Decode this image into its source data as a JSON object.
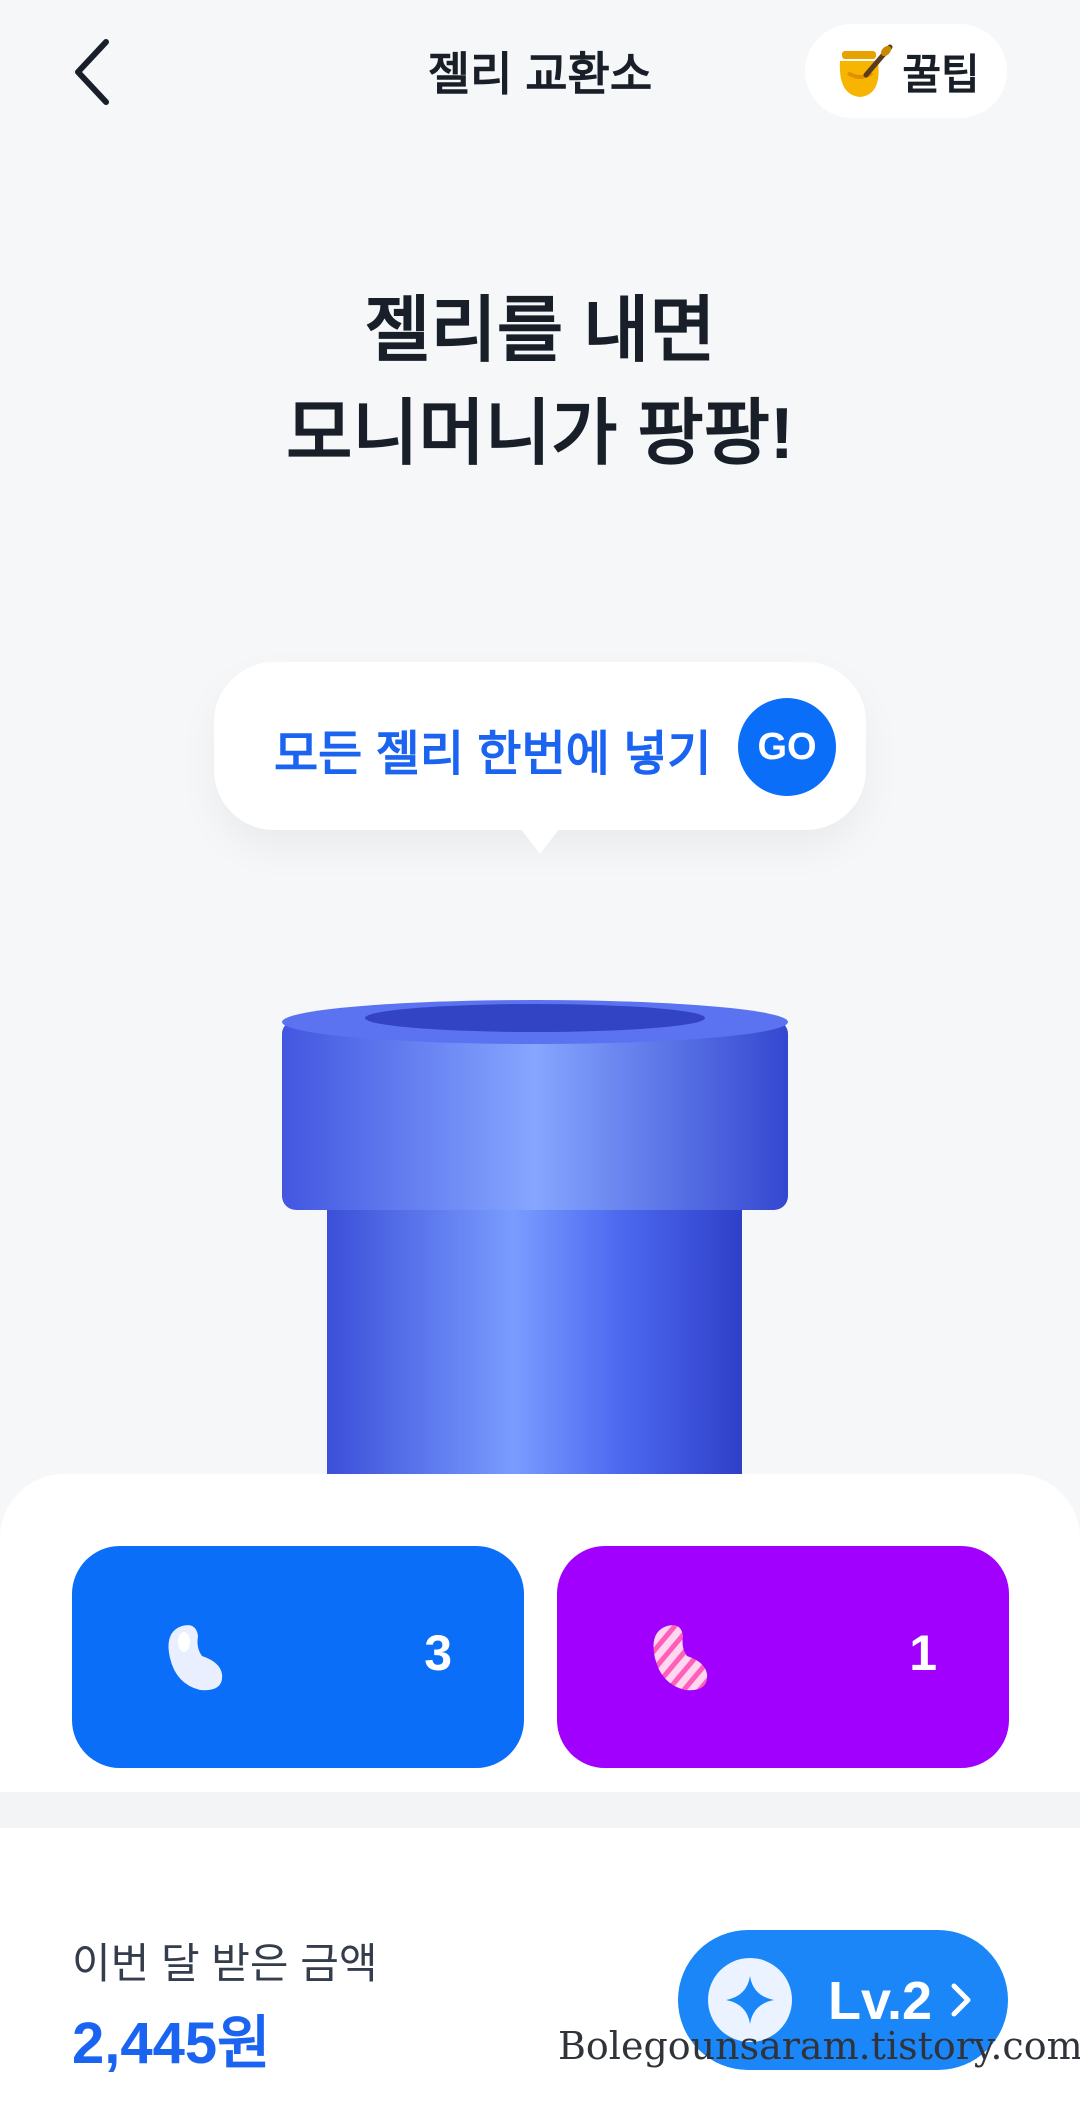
{
  "header": {
    "title": "젤리 교환소",
    "tip_label": "꿀팁"
  },
  "headline": {
    "line1": "젤리를 내면",
    "line2": "모니머니가 팡팡!"
  },
  "bubble": {
    "label": "모든 젤리 한번에 넣기",
    "go_label": "GO"
  },
  "jellies": [
    {
      "type": "basic",
      "count": "3",
      "color": "#0a6ef8"
    },
    {
      "type": "special",
      "count": "1",
      "color": "#a100ff"
    }
  ],
  "earnings": {
    "label": "이번 달 받은 금액",
    "value": "2,445원"
  },
  "level": {
    "label": "Lv.2"
  },
  "watermark": "Bolegounsaram.tistory.com",
  "colors": {
    "accent": "#1b64f2",
    "go": "#0a6ef8",
    "purple": "#a100ff"
  }
}
